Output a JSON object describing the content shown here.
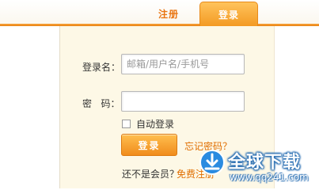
{
  "tabs": {
    "register_label": "注册",
    "login_label": "登录"
  },
  "form": {
    "username_label": "登录名：",
    "username_placeholder": "邮箱/用户名/手机号",
    "password_label": "密   码：",
    "password_value": "",
    "auto_login_label": "自动登录",
    "auto_login_checked": false,
    "login_button_label": "登录",
    "forgot_password_link": "忘记密码？",
    "not_member_text": "还不是会员？",
    "register_link": "免费注册"
  },
  "watermark": {
    "title": "全球下载",
    "url": "www.qq241.com"
  },
  "colors": {
    "accent": "#f39a23",
    "link": "#e06e00",
    "form_background": "#fdf8e6"
  }
}
